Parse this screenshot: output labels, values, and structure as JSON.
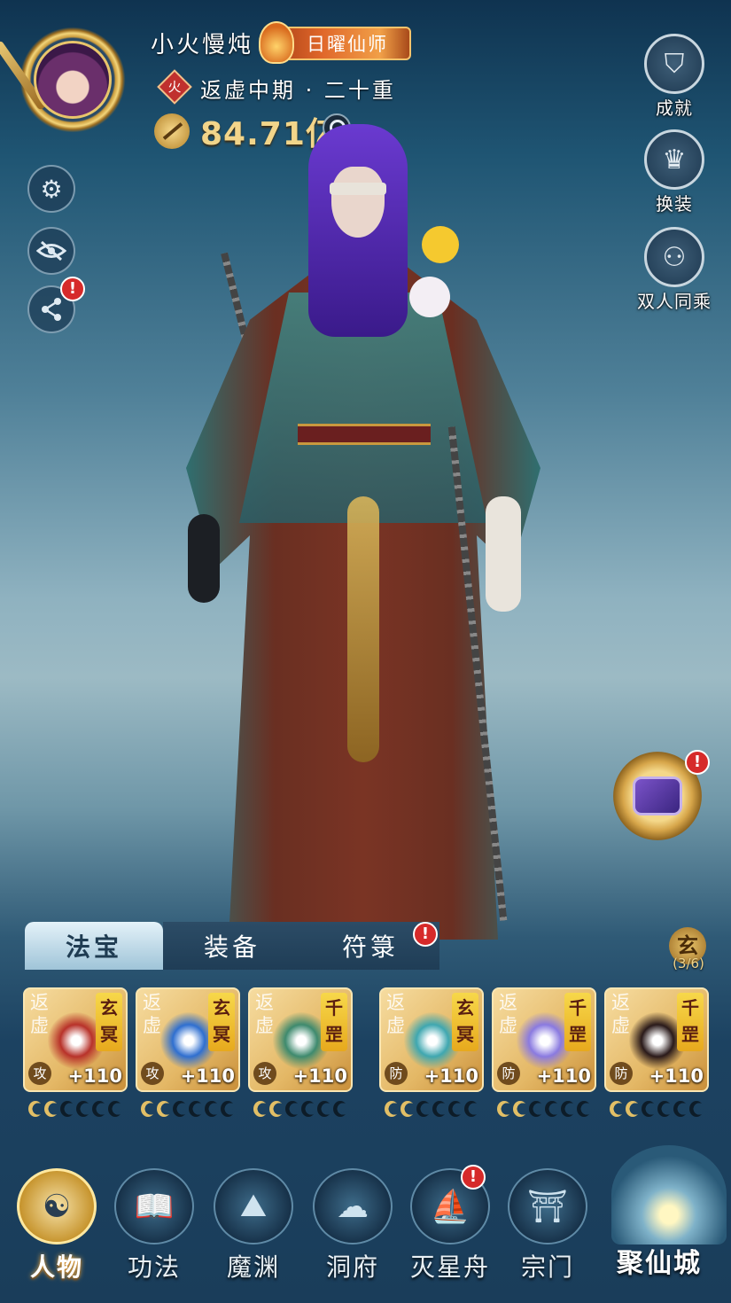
{
  "header": {
    "player_name": "小火慢炖",
    "title_badge": "日曜仙师",
    "element": "火",
    "realm": "返虚中期 · 二十重",
    "power": "84.71亿"
  },
  "left_buttons": [
    {
      "icon": "gear-icon",
      "alert": false
    },
    {
      "icon": "eye-slash-icon",
      "alert": false
    },
    {
      "icon": "share-icon",
      "alert": true
    }
  ],
  "right_menu": [
    {
      "label": "成就",
      "icon": "achievement-shield-icon"
    },
    {
      "label": "换装",
      "icon": "outfit-icon"
    },
    {
      "label": "双人同乘",
      "icon": "two-riders-icon"
    }
  ],
  "alert_mark": "!",
  "tabs": [
    {
      "label": "法宝",
      "active": true
    },
    {
      "label": "装备",
      "active": false
    },
    {
      "label": "符箓",
      "active": false,
      "alert": true
    }
  ],
  "grade_badge": {
    "label": "玄",
    "count": "(3/6)"
  },
  "items": [
    {
      "realm": "返虚",
      "grade": "玄冥",
      "type": "攻",
      "level": "+110",
      "stars_on": 2,
      "stars_total": 6,
      "art_color": "#b8322a"
    },
    {
      "realm": "返虚",
      "grade": "玄冥",
      "type": "攻",
      "level": "+110",
      "stars_on": 2,
      "stars_total": 6,
      "art_color": "#2f6fd0"
    },
    {
      "realm": "返虚",
      "grade": "千罡",
      "type": "攻",
      "level": "+110",
      "stars_on": 2,
      "stars_total": 6,
      "art_color": "#3e8a6e"
    },
    {
      "realm": "返虚",
      "grade": "玄冥",
      "type": "防",
      "level": "+110",
      "stars_on": 2,
      "stars_total": 6,
      "art_color": "#3fa7b0"
    },
    {
      "realm": "返虚",
      "grade": "千罡",
      "type": "防",
      "level": "+110",
      "stars_on": 2,
      "stars_total": 6,
      "art_color": "#8a7ae0"
    },
    {
      "realm": "返虚",
      "grade": "千罡",
      "type": "防",
      "level": "+110",
      "stars_on": 2,
      "stars_total": 6,
      "art_color": "#2a1a1a"
    }
  ],
  "nav": [
    {
      "label": "人物",
      "icon": "character-icon",
      "active": true,
      "alert": false
    },
    {
      "label": "功法",
      "icon": "technique-book-icon",
      "active": false,
      "alert": false
    },
    {
      "label": "魔渊",
      "icon": "abyss-icon",
      "active": false,
      "alert": false
    },
    {
      "label": "洞府",
      "icon": "cave-dwelling-icon",
      "active": false,
      "alert": false
    },
    {
      "label": "灭星舟",
      "icon": "star-ship-icon",
      "active": false,
      "alert": true
    },
    {
      "label": "宗门",
      "icon": "sect-pavilion-icon",
      "active": false,
      "alert": false
    }
  ],
  "city_button": {
    "label": "聚仙城",
    "icon": "immortal-city-icon"
  },
  "colors": {
    "accent_gold": "#f2d58a",
    "alert_red": "#d62a2a",
    "tab_active": "#e4f2f9"
  }
}
